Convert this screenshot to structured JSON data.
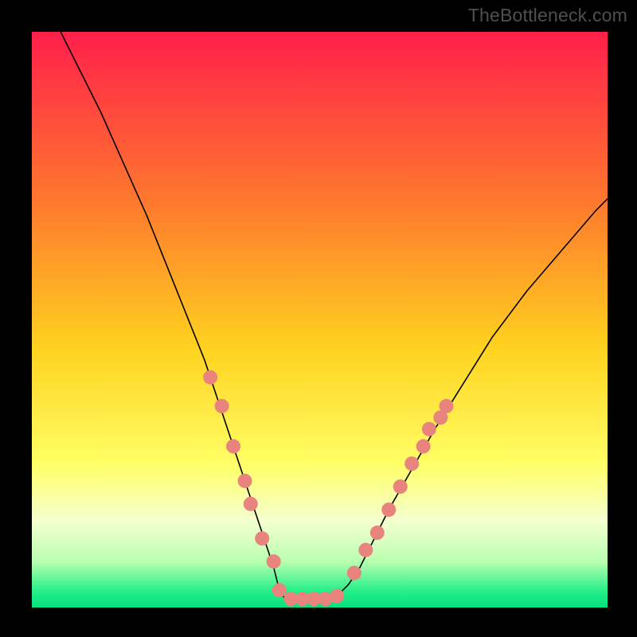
{
  "watermark": "TheBottleneck.com",
  "chart_data": {
    "type": "line",
    "title": "",
    "xlabel": "",
    "ylabel": "",
    "xlim": [
      0,
      100
    ],
    "ylim": [
      0,
      100
    ],
    "grid": false,
    "legend": false,
    "gradient_stops": [
      {
        "offset": 0,
        "color": "#ff1f4b"
      },
      {
        "offset": 30,
        "color": "#ff7a2d"
      },
      {
        "offset": 55,
        "color": "#ffd21f"
      },
      {
        "offset": 75,
        "color": "#ffff66"
      },
      {
        "offset": 85,
        "color": "#f4ffd0"
      },
      {
        "offset": 92,
        "color": "#baffb0"
      },
      {
        "offset": 97,
        "color": "#28f08a"
      },
      {
        "offset": 100,
        "color": "#02e27e"
      }
    ],
    "series": [
      {
        "name": "curve",
        "x": [
          5,
          8,
          12,
          16,
          20,
          24,
          28,
          30,
          32,
          34,
          36,
          38,
          40,
          42,
          43,
          44,
          46,
          50,
          53,
          55,
          57,
          59,
          62,
          66,
          70,
          75,
          80,
          86,
          92,
          98,
          100
        ],
        "y": [
          100,
          94,
          86,
          77,
          68,
          58,
          48,
          43,
          37,
          31,
          25,
          19,
          13,
          7,
          3,
          1.5,
          1.5,
          1.5,
          2,
          4,
          7,
          11,
          17,
          24,
          31,
          39,
          47,
          55,
          62,
          69,
          71
        ],
        "stroke": "#000000",
        "stroke_width": 1.6
      }
    ],
    "markers": {
      "name": "highlight-dots",
      "color": "#e8837e",
      "radius": 9,
      "points": [
        {
          "x": 31,
          "y": 40
        },
        {
          "x": 33,
          "y": 35
        },
        {
          "x": 35,
          "y": 28
        },
        {
          "x": 37,
          "y": 22
        },
        {
          "x": 38,
          "y": 18
        },
        {
          "x": 40,
          "y": 12
        },
        {
          "x": 42,
          "y": 8
        },
        {
          "x": 43,
          "y": 3
        },
        {
          "x": 45,
          "y": 1.5
        },
        {
          "x": 47,
          "y": 1.5
        },
        {
          "x": 49,
          "y": 1.5
        },
        {
          "x": 51,
          "y": 1.5
        },
        {
          "x": 53,
          "y": 2
        },
        {
          "x": 56,
          "y": 6
        },
        {
          "x": 58,
          "y": 10
        },
        {
          "x": 60,
          "y": 13
        },
        {
          "x": 62,
          "y": 17
        },
        {
          "x": 64,
          "y": 21
        },
        {
          "x": 66,
          "y": 25
        },
        {
          "x": 68,
          "y": 28
        },
        {
          "x": 69,
          "y": 31
        },
        {
          "x": 71,
          "y": 33
        },
        {
          "x": 72,
          "y": 35
        }
      ]
    }
  }
}
